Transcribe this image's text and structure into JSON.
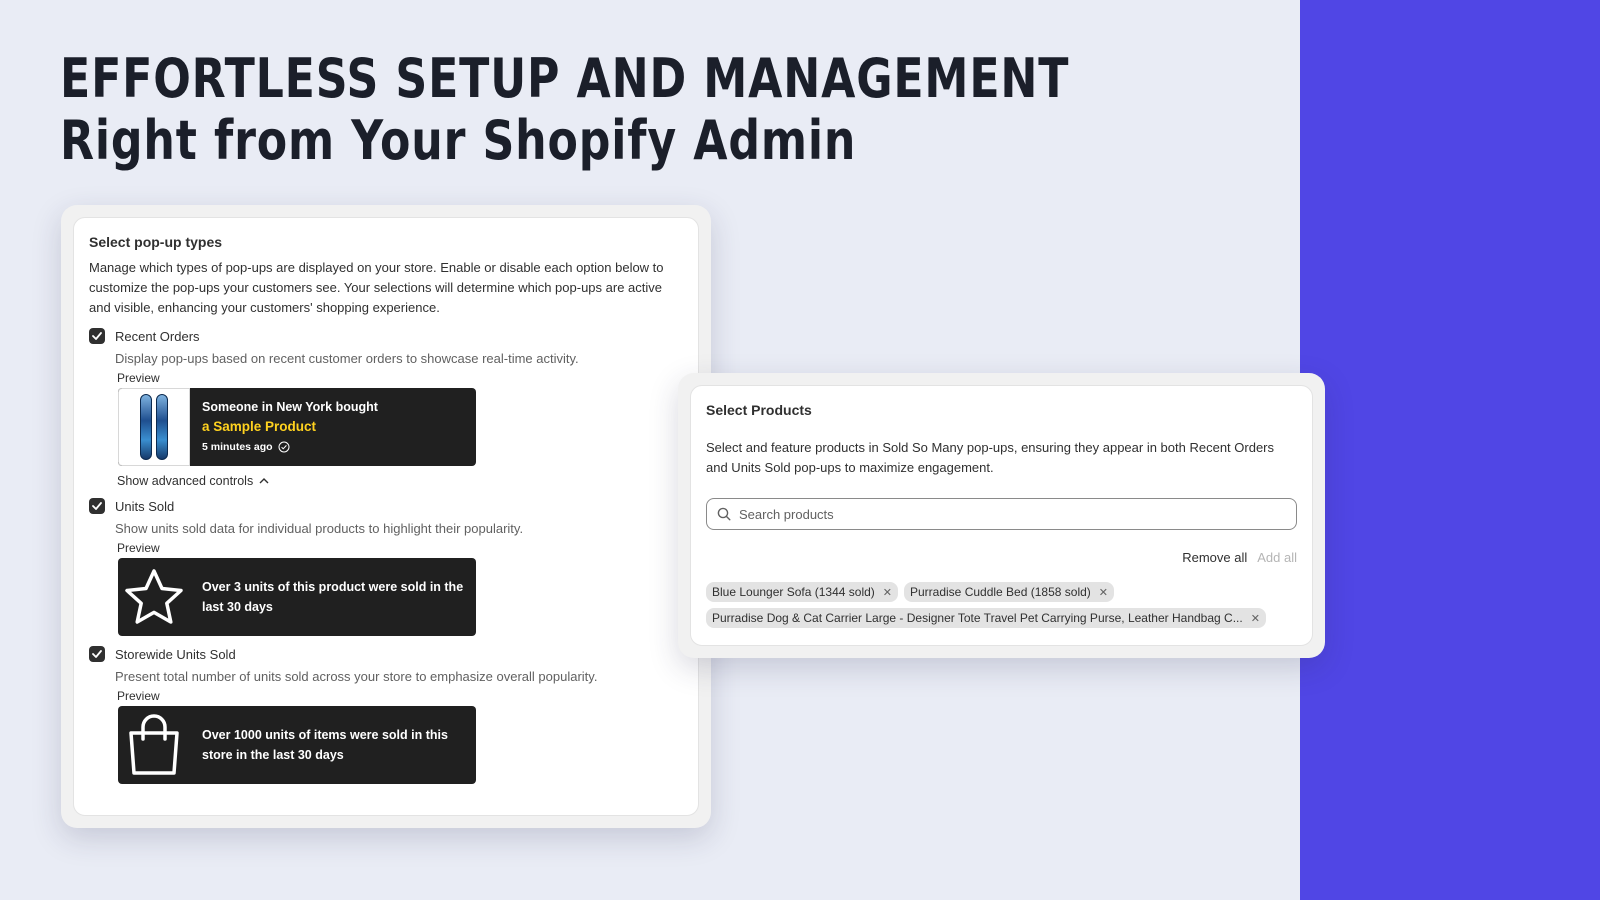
{
  "hero": {
    "line1": "EFFORTLESS SETUP AND MANAGEMENT",
    "line2": "Right from Your Shopify Admin"
  },
  "colors": {
    "background": "#e9ecf5",
    "accent": "#5046e5",
    "popup_bg": "#202020",
    "highlight": "#ffd21f"
  },
  "popup_types": {
    "title": "Select pop-up types",
    "description": "Manage which types of pop-ups are displayed on your store. Enable or disable each option below to customize the pop-ups your customers see. Your selections will determine which pop-ups are active and visible, enhancing your customers' shopping experience.",
    "options": [
      {
        "label": "Recent Orders",
        "checked": true,
        "description": "Display pop-ups based on recent customer orders to showcase real-time activity.",
        "preview_label": "Preview",
        "popup": {
          "line1": "Someone in New York bought",
          "product": "a Sample Product",
          "time": "5 minutes ago",
          "icon": "snowboard-image"
        }
      },
      {
        "label": "Units Sold",
        "checked": true,
        "description": "Show units sold data for individual products to highlight their popularity.",
        "preview_label": "Preview",
        "popup": {
          "line1": "Over 3 units of this product were sold in the",
          "line2": "last 30 days",
          "icon": "star-icon"
        }
      },
      {
        "label": "Storewide Units Sold",
        "checked": true,
        "description": "Present total number of units sold across your store to emphasize overall popularity.",
        "preview_label": "Preview",
        "popup": {
          "line1": "Over 1000 units of items were sold in this",
          "line2": "store in the last 30 days",
          "icon": "shopping-bag-icon"
        }
      }
    ],
    "advanced_controls": "Show advanced controls"
  },
  "products": {
    "title": "Select Products",
    "description": "Select and feature products in Sold So Many pop-ups, ensuring they appear in both Recent Orders and Units Sold pop-ups to maximize engagement.",
    "search_placeholder": "Search products",
    "remove_all": "Remove all",
    "add_all": "Add all",
    "tags": [
      "Blue Lounger Sofa (1344 sold)",
      "Purradise Cuddle Bed (1858 sold)",
      "Purradise Dog & Cat Carrier Large - Designer Tote Travel Pet Carrying Purse, Leather Handbag C..."
    ]
  }
}
